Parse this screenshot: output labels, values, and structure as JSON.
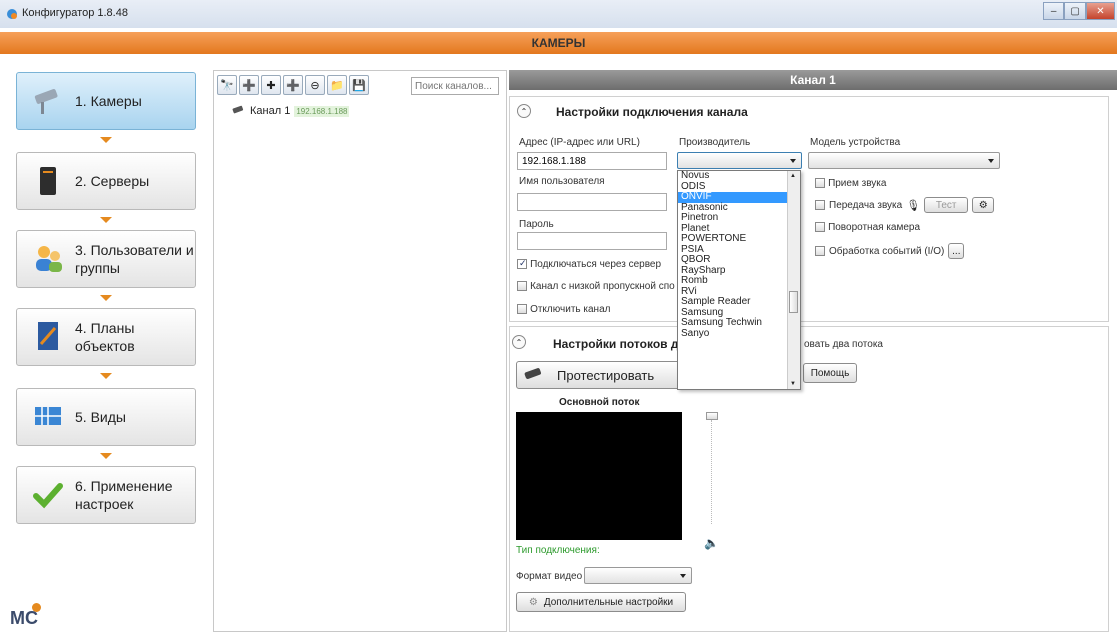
{
  "window": {
    "title": "Конфигуратор 1.8.48"
  },
  "header": {
    "title": "КАМЕРЫ"
  },
  "nav": {
    "items": [
      {
        "label": "1. Камеры",
        "active": true
      },
      {
        "label": "2. Серверы"
      },
      {
        "label": "3. Пользователи и группы"
      },
      {
        "label": "4. Планы объектов"
      },
      {
        "label": "5. Виды"
      },
      {
        "label": "6. Применение настроек"
      }
    ]
  },
  "logo": {
    "text": "MC"
  },
  "tree": {
    "search_placeholder": "Поиск каналов...",
    "channels": [
      {
        "name": "Канал 1",
        "ip": "192.168.1.188"
      }
    ]
  },
  "channel": {
    "title": "Канал 1",
    "connection": {
      "title": "Настройки подключения канала",
      "address_label": "Адрес (IP-адрес или URL)",
      "address_value": "192.168.1.188",
      "manufacturer_label": "Производитель",
      "model_label": "Модель устройства",
      "username_label": "Имя пользователя",
      "password_label": "Пароль",
      "via_server_label": "Подключаться через сервер",
      "via_server_checked": true,
      "low_bandwidth_label": "Канал с низкой пропускной спо",
      "disable_label": "Отключить канал",
      "audio_in_label": "Прием звука",
      "audio_out_label": "Передача звука",
      "test_label": "Тест",
      "ptz_label": "Поворотная камера",
      "events_label": "Обработка событий (I/O)",
      "events_btn": "..."
    },
    "manufacturer_options": [
      "Novus",
      "ODIS",
      "ONVIF",
      "Panasonic",
      "Pinetron",
      "Planet",
      "POWERTONE",
      "PSIA",
      "QBOR",
      "RaySharp",
      "Romb",
      "RVi",
      "Sample Reader",
      "Samsung",
      "Samsung Techwin",
      "Sanyo"
    ],
    "manufacturer_selected_index": 2,
    "streams": {
      "title": "Настройки потоков д",
      "two_streams_label": "овать два потока",
      "test_button": "Протестировать",
      "help_button": "Помощь",
      "main_stream_label": "Основной поток",
      "connection_type_label": "Тип подключения:",
      "video_format_label": "Формат видео",
      "advanced_button": "Дополнительные настройки"
    }
  },
  "colors": {
    "accent": "#e58a1f",
    "selection": "#3399ff",
    "nav_active": "#a9d4ef"
  }
}
